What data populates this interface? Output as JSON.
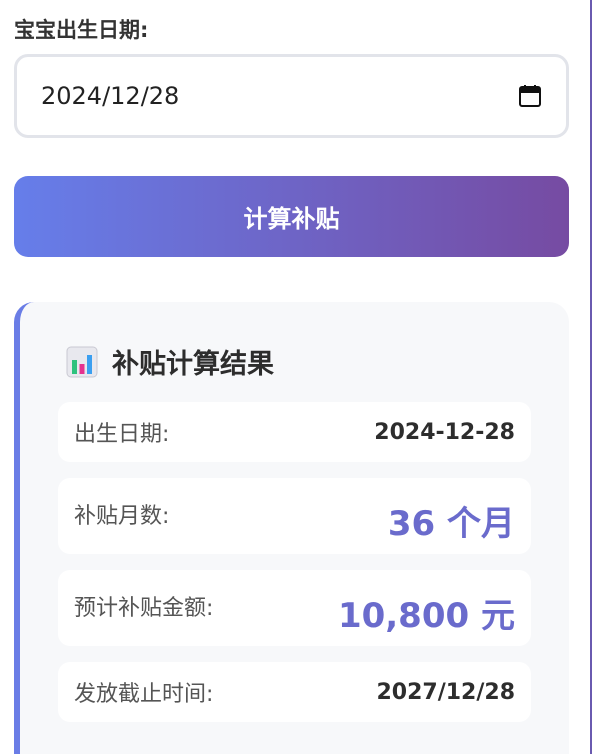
{
  "form": {
    "birth_date_label": "宝宝出生日期:",
    "birth_date_value": "2024/12/28"
  },
  "calculate_button": {
    "label": "计算补贴"
  },
  "result": {
    "title": "补贴计算结果",
    "icon": "bar-chart-icon",
    "rows": [
      {
        "label": "出生日期:",
        "value": "2024-12-28"
      },
      {
        "label": "补贴月数:",
        "value": "36 个月"
      },
      {
        "label": "预计补贴金额:",
        "value": "10,800 元"
      },
      {
        "label": "发放截止时间:",
        "value": "2027/12/28"
      }
    ]
  },
  "colors": {
    "accent_start": "#667eea",
    "accent_end": "#764ba2",
    "highlight_value": "#6a6bcc"
  }
}
